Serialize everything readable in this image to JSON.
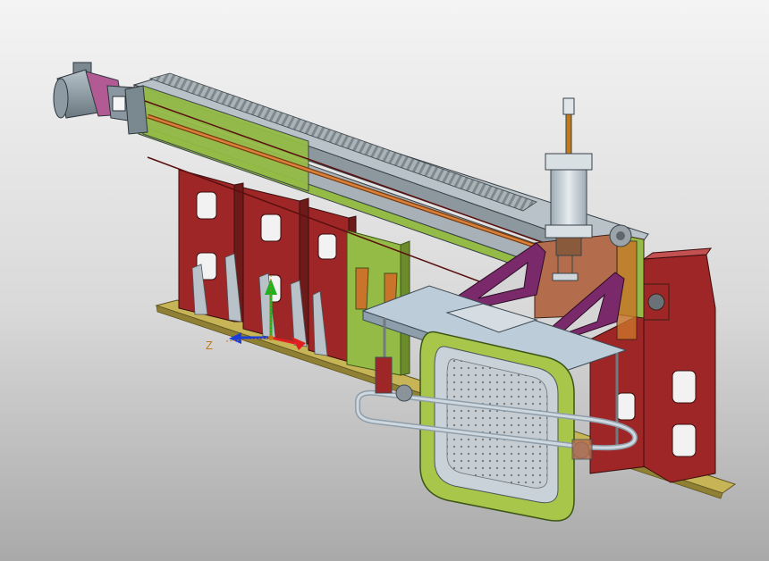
{
  "viewport": {
    "background_top": "#f4f4f4",
    "background_bottom": "#a9a9a9"
  },
  "triad": {
    "z_label": "Z",
    "x_color": "#e02020",
    "y_color": "#20b020",
    "z_color": "#1b3fd6"
  },
  "colors": {
    "base_plate": "#c7b457",
    "frame_red": "#9e2626",
    "frame_green": "#94bb46",
    "rail_grey": "#b8c2c8",
    "rack": "#8a9499",
    "drive_rod": "#c0661f",
    "motor": "#8d9aa3",
    "gearbox": "#b25a93",
    "bracket_purple": "#7a2a6a",
    "carriage_copper": "#b46d4c",
    "cylinder": "#c7d1d8",
    "platform": "#bcccd8",
    "gripper_frame": "#a8c74a",
    "gripper_plate": "#b9c4cc"
  }
}
